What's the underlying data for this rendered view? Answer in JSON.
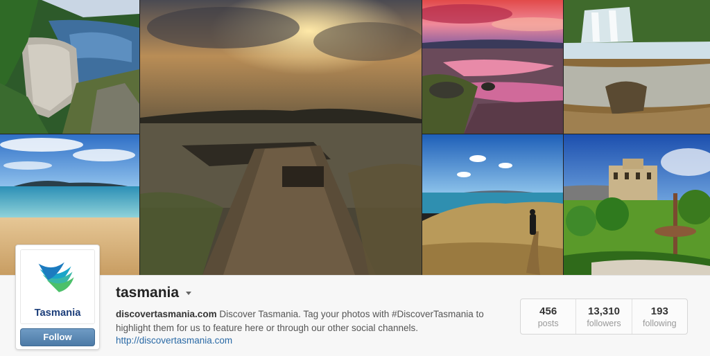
{
  "profile": {
    "username": "tasmania",
    "logo_text": "Tasmania",
    "follow_label": "Follow",
    "bio_site": "discovertasmania.com",
    "bio_text": " Discover Tasmania. Tag your photos with #DiscoverTasmania to highlight them for us to feature here or through our other social channels.",
    "link": "http://discovertasmania.com"
  },
  "stats": [
    {
      "value": "456",
      "label": "posts"
    },
    {
      "value": "13,310",
      "label": "followers"
    },
    {
      "value": "193",
      "label": "following"
    }
  ],
  "icons": {
    "username_menu": "caret-down-icon"
  },
  "colors": {
    "follow_button": "#4c7aa6",
    "link": "#2a6aa6"
  }
}
